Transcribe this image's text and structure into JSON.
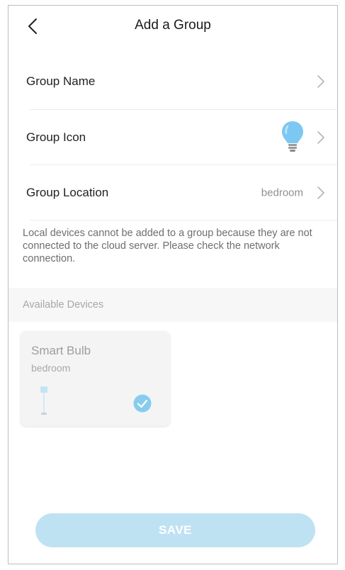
{
  "header": {
    "title": "Add a Group",
    "back_icon": "back-arrow-icon"
  },
  "rows": {
    "name": {
      "label": "Group Name"
    },
    "icon": {
      "label": "Group Icon",
      "icon": "lightbulb-icon"
    },
    "location": {
      "label": "Group Location",
      "value": "bedroom"
    }
  },
  "notice": "Local devices cannot be added to a group because they are not connected to the cloud server. Please check the network connection.",
  "available": {
    "title": "Available Devices",
    "devices": [
      {
        "name": "Smart Bulb",
        "location": "bedroom",
        "selected": true
      }
    ]
  },
  "save_label": "SAVE",
  "colors": {
    "accent": "#4fb3e8",
    "save_disabled": "#bfe2f3",
    "bulb": "#7cc8f2"
  }
}
